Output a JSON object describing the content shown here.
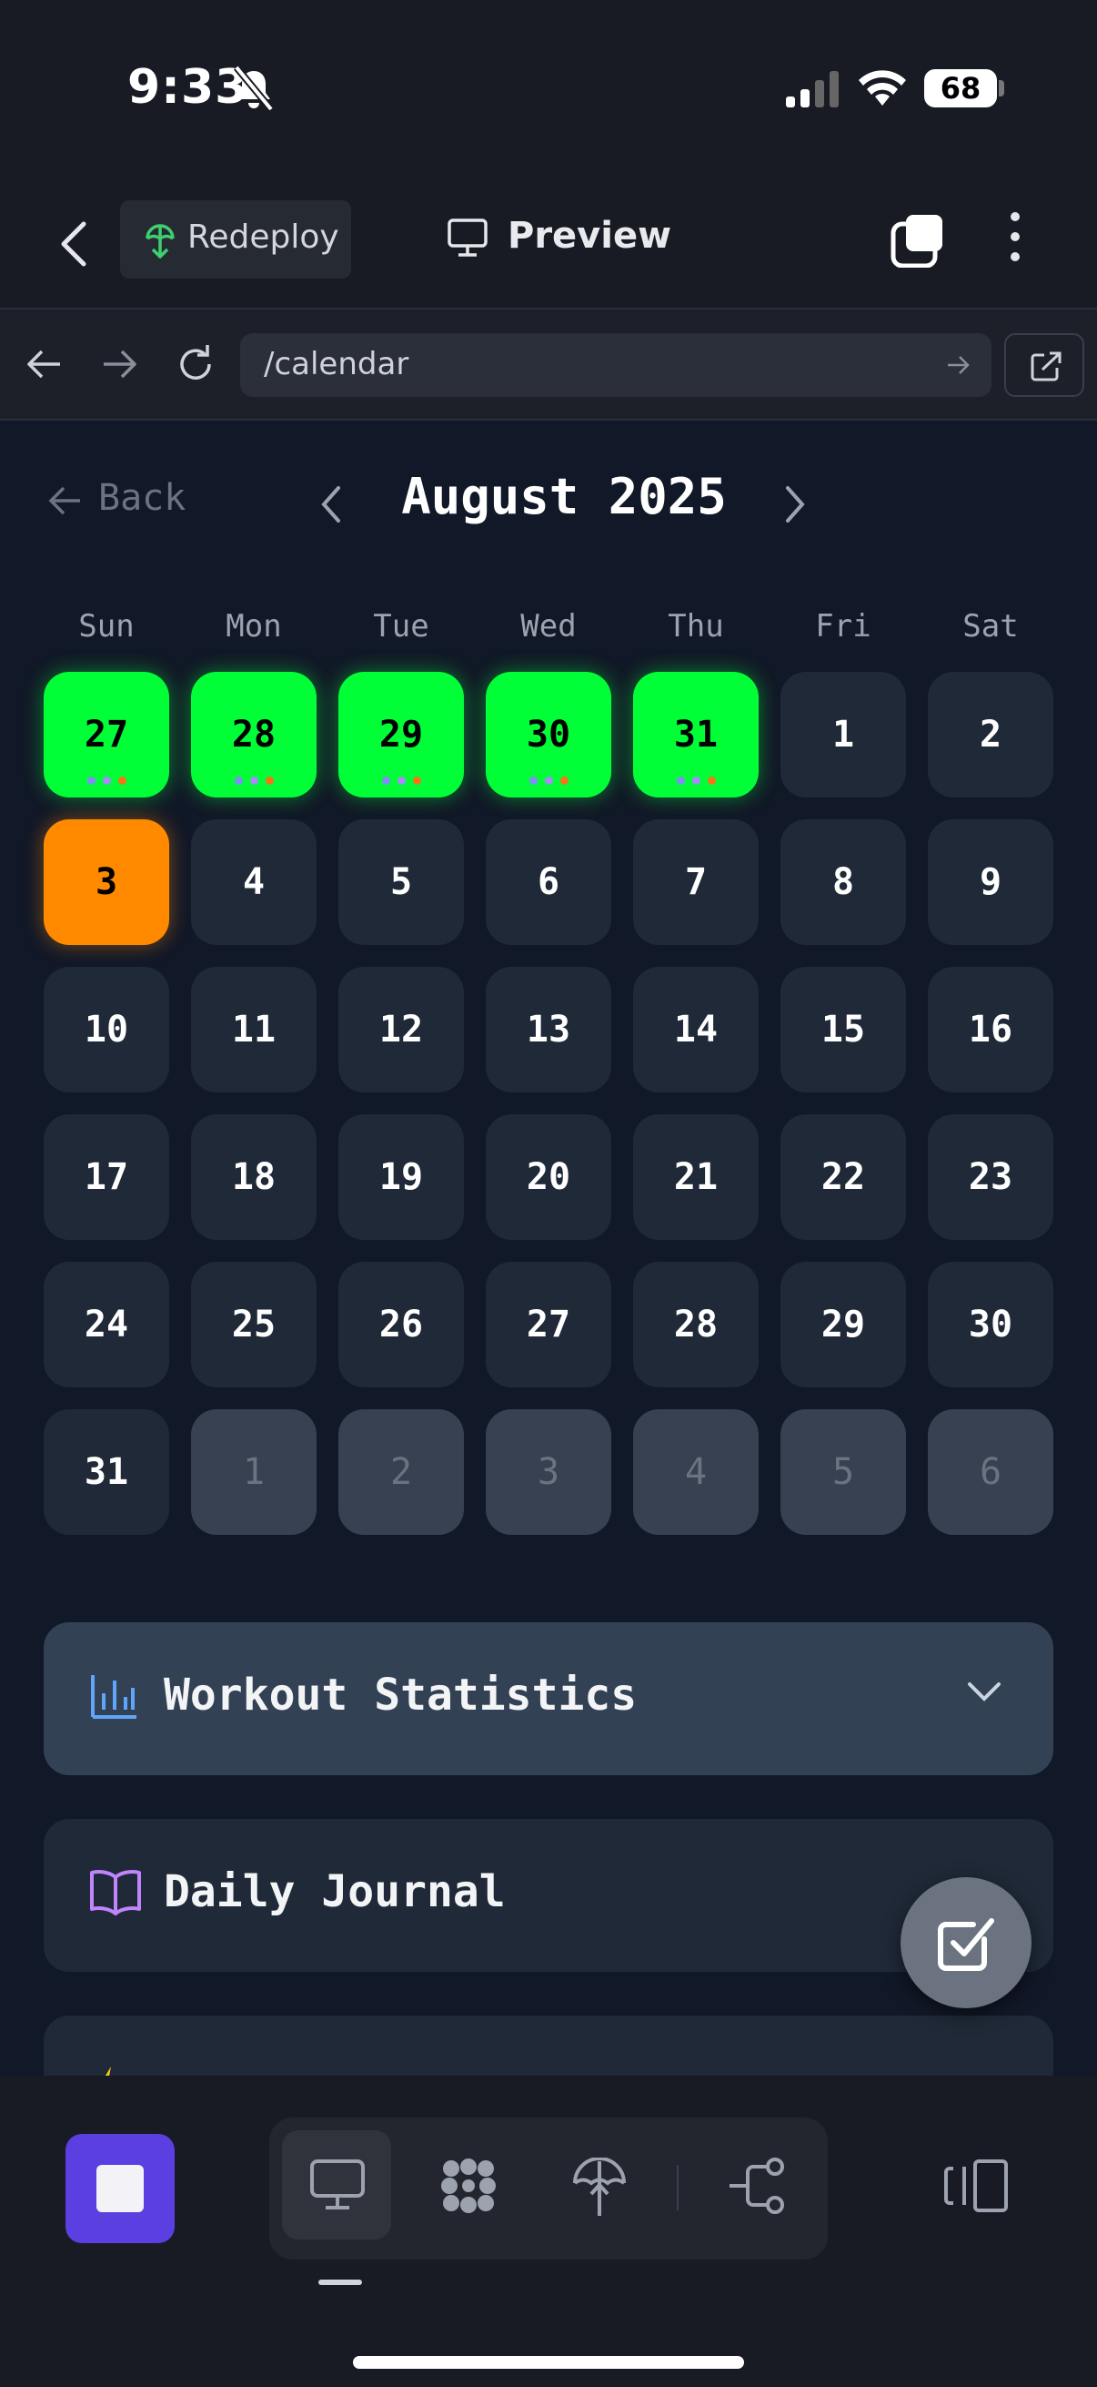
{
  "status_bar": {
    "time": "9:33",
    "battery": "68",
    "icons": [
      "bell-slash-icon",
      "cellular-signal-icon",
      "wifi-icon",
      "battery-icon"
    ]
  },
  "header": {
    "redeploy_label": "Redeploy",
    "preview_label": "Preview"
  },
  "browser": {
    "url": "/calendar"
  },
  "calendar": {
    "back_label": "Back",
    "month_title": "August 2025",
    "weekdays": [
      "Sun",
      "Mon",
      "Tue",
      "Wed",
      "Thu",
      "Fri",
      "Sat"
    ],
    "colors": {
      "completed": "#00ff37",
      "today": "#ff8a00",
      "cell": "#1f2937",
      "muted_cell": "#374151"
    },
    "dot_colors": [
      "#818cf8",
      "#a78bfa",
      "#f97316"
    ],
    "weeks": [
      [
        {
          "day": "27",
          "state": "completed",
          "dots": true
        },
        {
          "day": "28",
          "state": "completed",
          "dots": true
        },
        {
          "day": "29",
          "state": "completed",
          "dots": true
        },
        {
          "day": "30",
          "state": "completed",
          "dots": true
        },
        {
          "day": "31",
          "state": "completed",
          "dots": true
        },
        {
          "day": "1",
          "state": "normal"
        },
        {
          "day": "2",
          "state": "normal"
        }
      ],
      [
        {
          "day": "3",
          "state": "today"
        },
        {
          "day": "4",
          "state": "normal"
        },
        {
          "day": "5",
          "state": "normal"
        },
        {
          "day": "6",
          "state": "normal"
        },
        {
          "day": "7",
          "state": "normal"
        },
        {
          "day": "8",
          "state": "normal"
        },
        {
          "day": "9",
          "state": "normal"
        }
      ],
      [
        {
          "day": "10",
          "state": "normal"
        },
        {
          "day": "11",
          "state": "normal"
        },
        {
          "day": "12",
          "state": "normal"
        },
        {
          "day": "13",
          "state": "normal"
        },
        {
          "day": "14",
          "state": "normal"
        },
        {
          "day": "15",
          "state": "normal"
        },
        {
          "day": "16",
          "state": "normal"
        }
      ],
      [
        {
          "day": "17",
          "state": "normal"
        },
        {
          "day": "18",
          "state": "normal"
        },
        {
          "day": "19",
          "state": "normal"
        },
        {
          "day": "20",
          "state": "normal"
        },
        {
          "day": "21",
          "state": "normal"
        },
        {
          "day": "22",
          "state": "normal"
        },
        {
          "day": "23",
          "state": "normal"
        }
      ],
      [
        {
          "day": "24",
          "state": "normal"
        },
        {
          "day": "25",
          "state": "normal"
        },
        {
          "day": "26",
          "state": "normal"
        },
        {
          "day": "27",
          "state": "normal"
        },
        {
          "day": "28",
          "state": "normal"
        },
        {
          "day": "29",
          "state": "normal"
        },
        {
          "day": "30",
          "state": "normal"
        }
      ],
      [
        {
          "day": "31",
          "state": "normal"
        },
        {
          "day": "1",
          "state": "muted"
        },
        {
          "day": "2",
          "state": "muted"
        },
        {
          "day": "3",
          "state": "muted"
        },
        {
          "day": "4",
          "state": "muted"
        },
        {
          "day": "5",
          "state": "muted"
        },
        {
          "day": "6",
          "state": "muted"
        }
      ]
    ]
  },
  "panels": {
    "stats_title": "Workout Statistics",
    "journal_title": "Daily Journal"
  },
  "bottom_bar": {
    "tools": [
      "monitor-icon",
      "cluster-icon",
      "deploy-icon",
      "workflow-icon"
    ],
    "accent": "#5b3fe0"
  }
}
